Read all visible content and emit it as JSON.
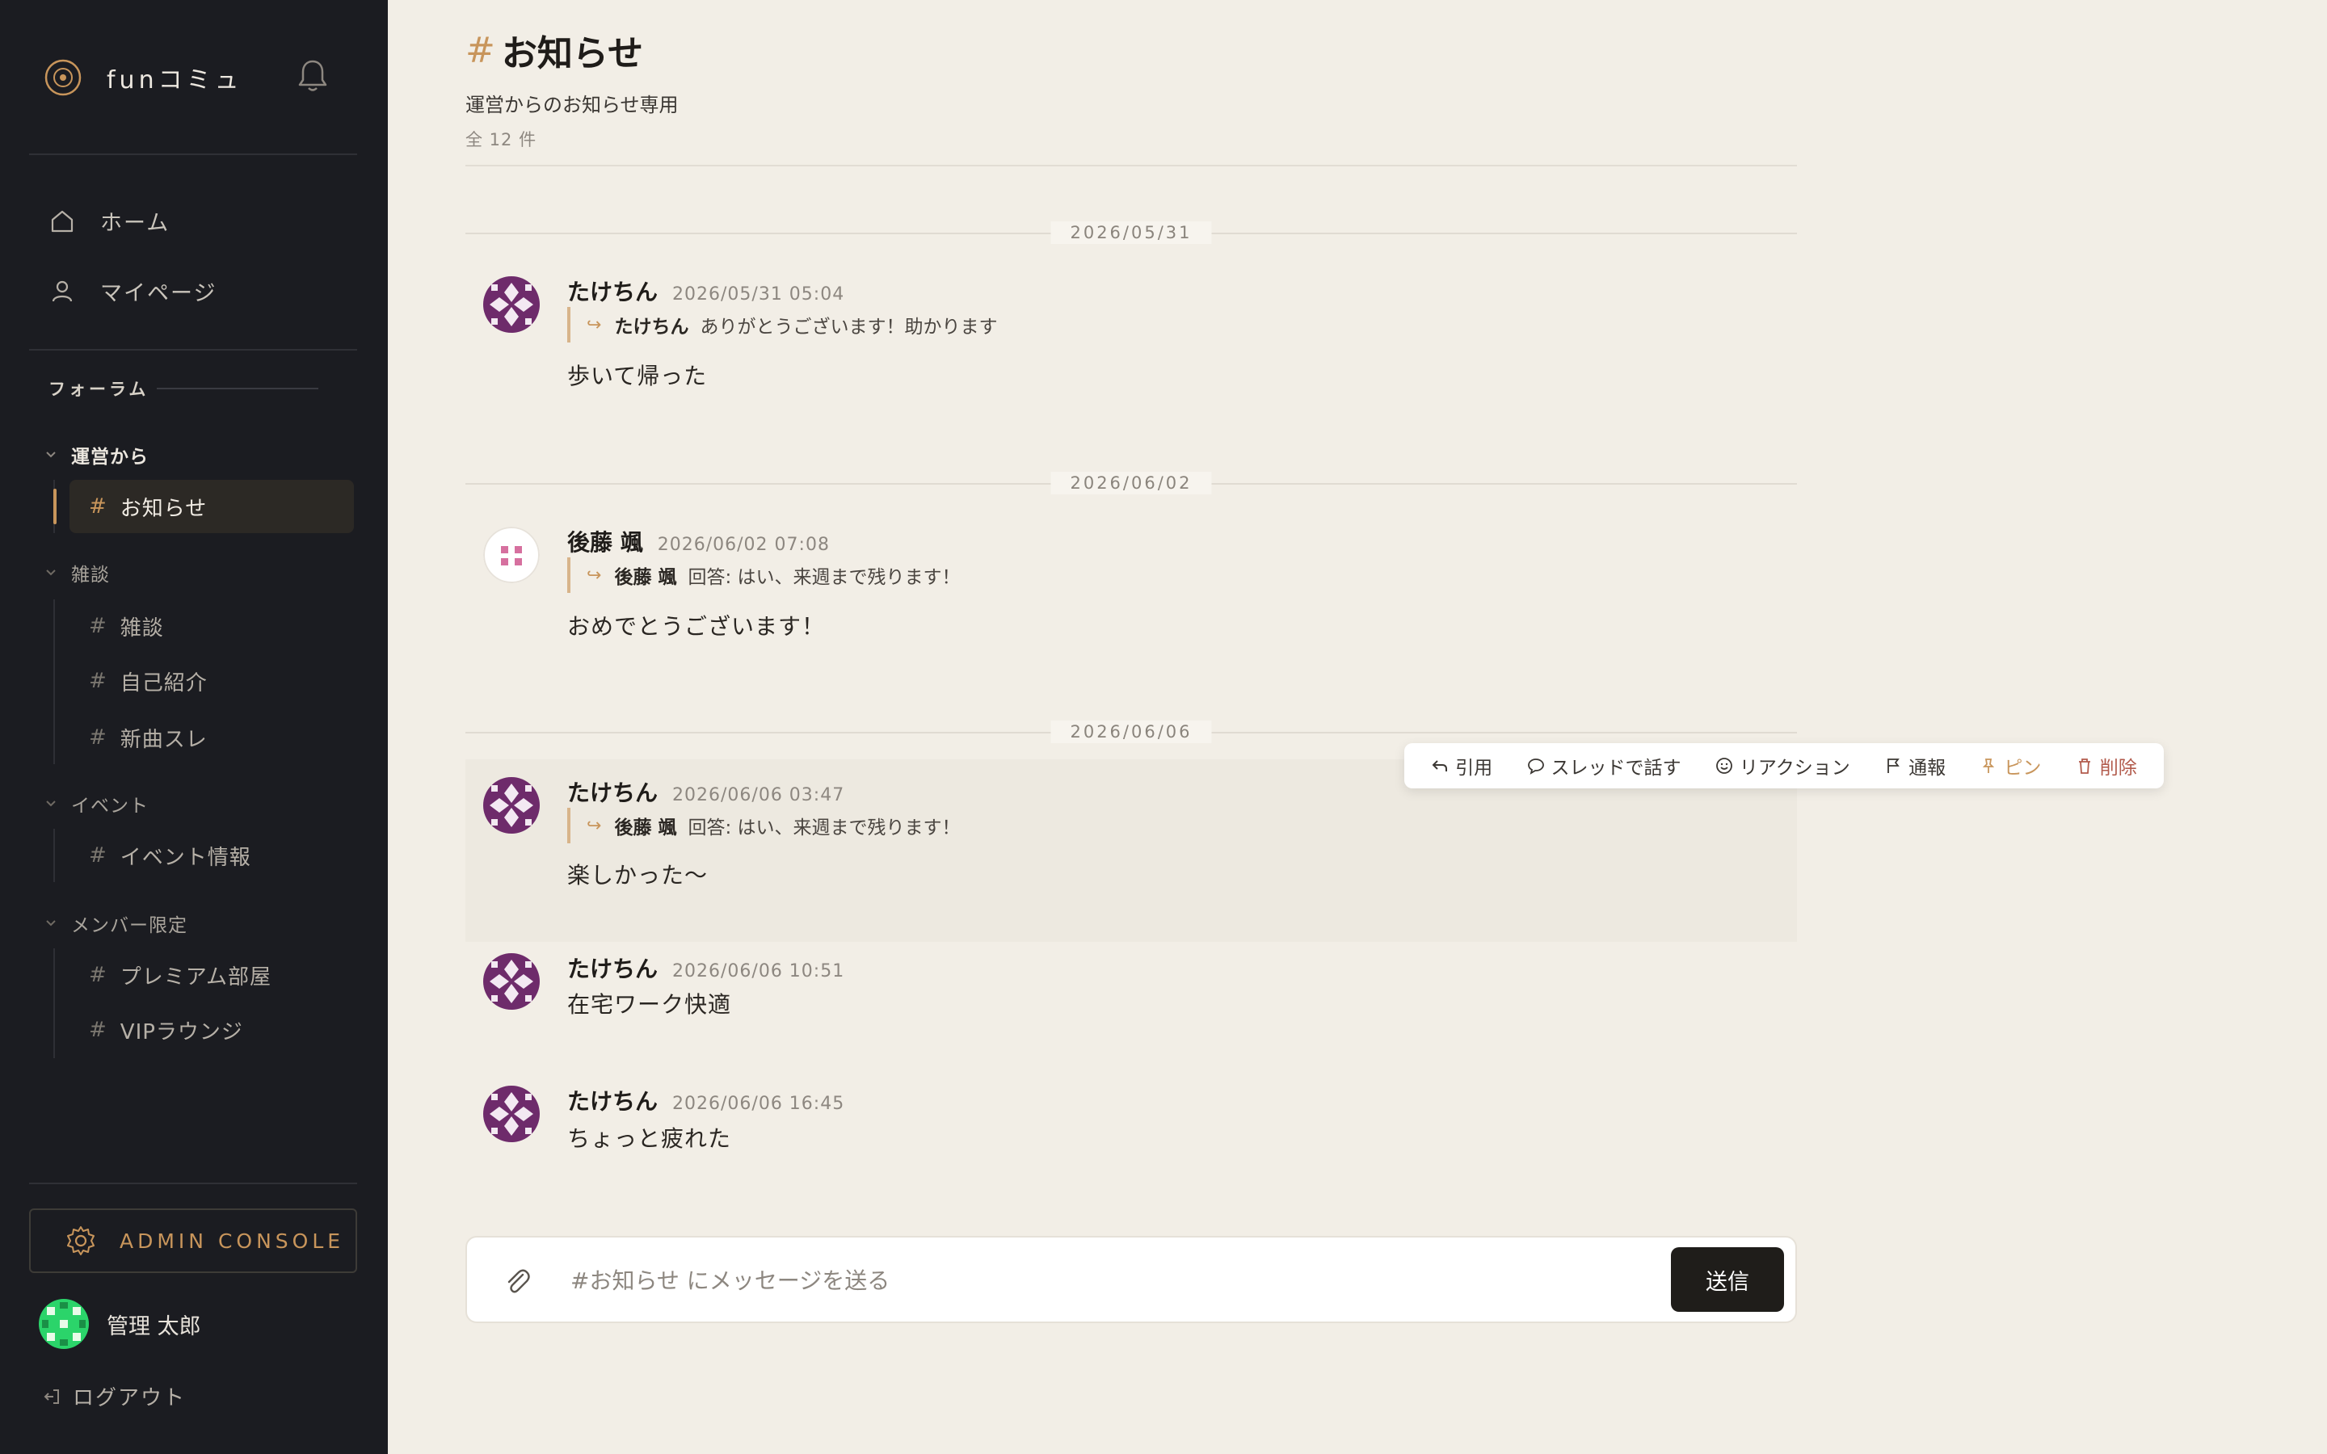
{
  "app": {
    "name": "funコミュ",
    "accent_color": "#c8955b",
    "sidebar_bg": "#1b1c21",
    "main_bg": "#f2eee6"
  },
  "nav": [
    {
      "label": "ホーム",
      "icon": "home-icon"
    },
    {
      "label": "マイページ",
      "icon": "user-icon"
    }
  ],
  "forum": {
    "label": "フォーラム",
    "categories": [
      {
        "label": "運営から",
        "active": true,
        "channels": [
          {
            "label": "お知らせ",
            "active": true
          }
        ]
      },
      {
        "label": "雑談",
        "channels": [
          {
            "label": "雑談"
          },
          {
            "label": "自己紹介"
          },
          {
            "label": "新曲スレ"
          }
        ]
      },
      {
        "label": "イベント",
        "channels": [
          {
            "label": "イベント情報"
          }
        ]
      },
      {
        "label": "メンバー限定",
        "channels": [
          {
            "label": "プレミアム部屋"
          },
          {
            "label": "VIPラウンジ"
          }
        ]
      }
    ]
  },
  "admin_console_label": "ADMIN CONSOLE",
  "user": {
    "name": "管理 太郎"
  },
  "logout_label": "ログアウト",
  "channel": {
    "title": "お知らせ",
    "description": "運営からのお知らせ専用",
    "count": "全 12 件"
  },
  "date_separators": [
    "2026/05/31",
    "2026/06/02",
    "2026/06/06"
  ],
  "messages": [
    {
      "author": "たけちん",
      "time": "2026/05/31 05:04",
      "quote_author": "たけちん",
      "quote_text": "ありがとうございます！助かります",
      "body": "歩いて帰った"
    },
    {
      "author": "後藤 颯",
      "time": "2026/06/02 07:08",
      "quote_author": "後藤 颯",
      "quote_text": "回答: はい、来週まで残ります！",
      "body": "おめでとうございます！"
    },
    {
      "author": "たけちん",
      "time": "2026/06/06 03:47",
      "quote_author": "後藤 颯",
      "quote_text": "回答: はい、来週まで残ります！",
      "body": "楽しかった〜"
    },
    {
      "author": "たけちん",
      "time": "2026/06/06 10:51",
      "body": "在宅ワーク快適"
    },
    {
      "author": "たけちん",
      "time": "2026/06/06 16:45",
      "body": "ちょっと疲れた"
    }
  ],
  "toolbar": {
    "quote": "引用",
    "thread": "スレッドで話す",
    "reaction": "リアクション",
    "report": "通報",
    "pin": "ピン",
    "delete": "削除"
  },
  "composer": {
    "placeholder": "#お知らせ にメッセージを送る",
    "value": "",
    "send_label": "送信"
  }
}
